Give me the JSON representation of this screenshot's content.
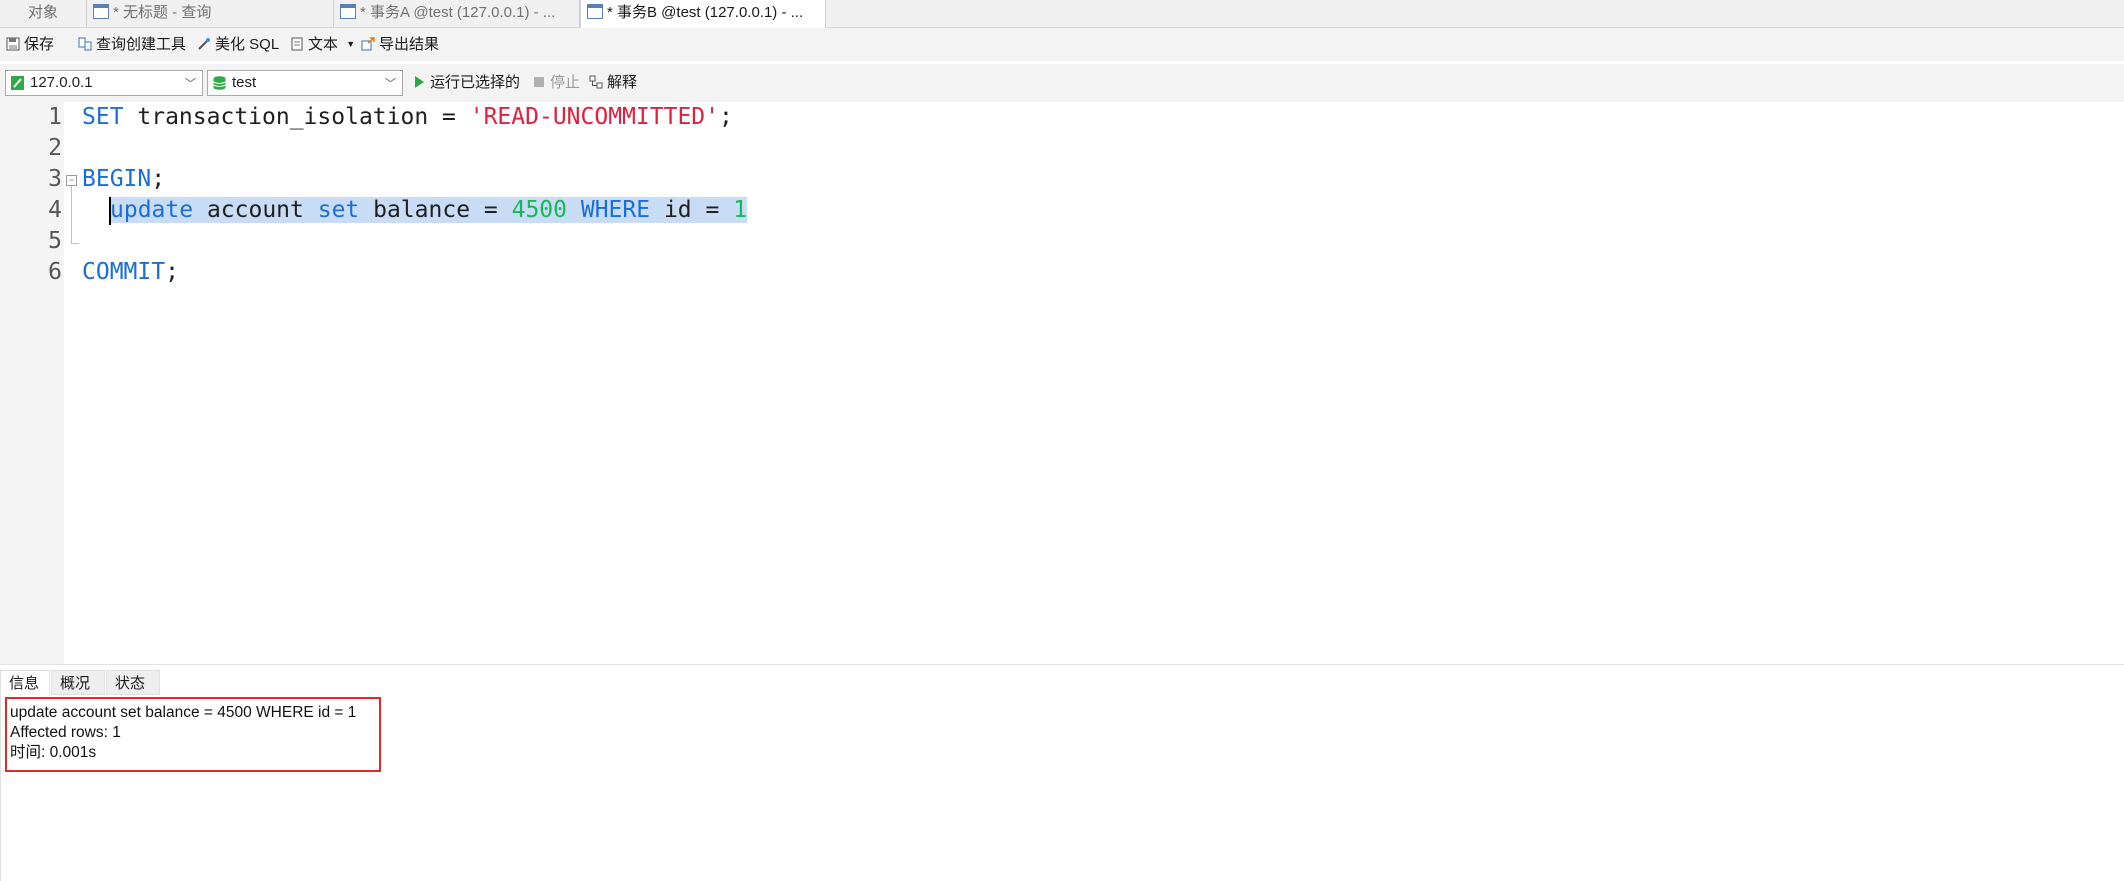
{
  "tabs": [
    {
      "label": "对象",
      "icon": "none"
    },
    {
      "label": "* 无标题 - 查询",
      "icon": "query-table-icon"
    },
    {
      "label": "* 事务A @test (127.0.0.1) - ...",
      "icon": "query-table-icon"
    },
    {
      "label": "* 事务B @test (127.0.0.1) - ...",
      "icon": "query-table-icon"
    }
  ],
  "toolbar": {
    "save": "保存",
    "query_builder": "查询创建工具",
    "beautify_sql": "美化 SQL",
    "text": "文本",
    "export_result": "导出结果"
  },
  "run_bar": {
    "connection": "127.0.0.1",
    "database": "test",
    "run_selected": "运行已选择的",
    "stop": "停止",
    "explain": "解释"
  },
  "editor": {
    "line_numbers": [
      "1",
      "2",
      "3",
      "4",
      "5",
      "6"
    ],
    "line1": {
      "kw": "SET",
      "rest": " transaction_isolation = ",
      "str": "'READ-UNCOMMITTED'",
      "end": ";"
    },
    "line3": {
      "kw": "BEGIN",
      "end": ";"
    },
    "line4": {
      "kw1": "update",
      "t1": " account ",
      "kw2": "set",
      "t2": " balance = ",
      "n1": "4500",
      "sp": " ",
      "kw3": "WHERE",
      "t3": " id = ",
      "n2": "1"
    },
    "line6": {
      "kw": "COMMIT",
      "end": ";"
    },
    "colors": {
      "keyword": "#1a6fd6",
      "string": "#e0203c",
      "number": "#17b85a",
      "selection": "#c9dcf5"
    }
  },
  "result_panel": {
    "tabs": [
      "信息",
      "概况",
      "状态"
    ],
    "lines": [
      "update account set balance = 4500 WHERE id = 1",
      "Affected rows: 1",
      "时间: 0.001s"
    ],
    "highlight_color": "#e02a2a"
  }
}
